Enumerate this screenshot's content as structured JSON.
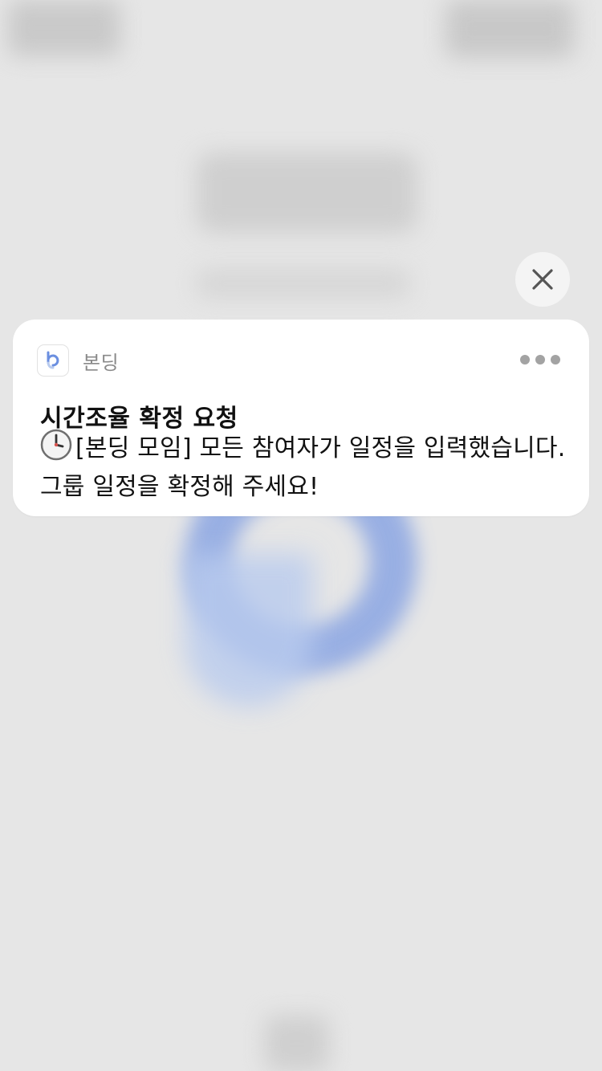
{
  "notification": {
    "app_name": "본딩",
    "title": "시간조율 확정 요청",
    "body_icon": "clock-icon",
    "body": "[본딩 모임] 모든 참여자가 일정을 입력했습니다. 그룹 일정을 확정해 주세요!"
  },
  "controls": {
    "close_icon": "close-icon",
    "more_icon": "more-dots-icon"
  },
  "colors": {
    "background": "#e6e6e6",
    "card": "#ffffff",
    "brand_blue": "#6b8fe0"
  }
}
